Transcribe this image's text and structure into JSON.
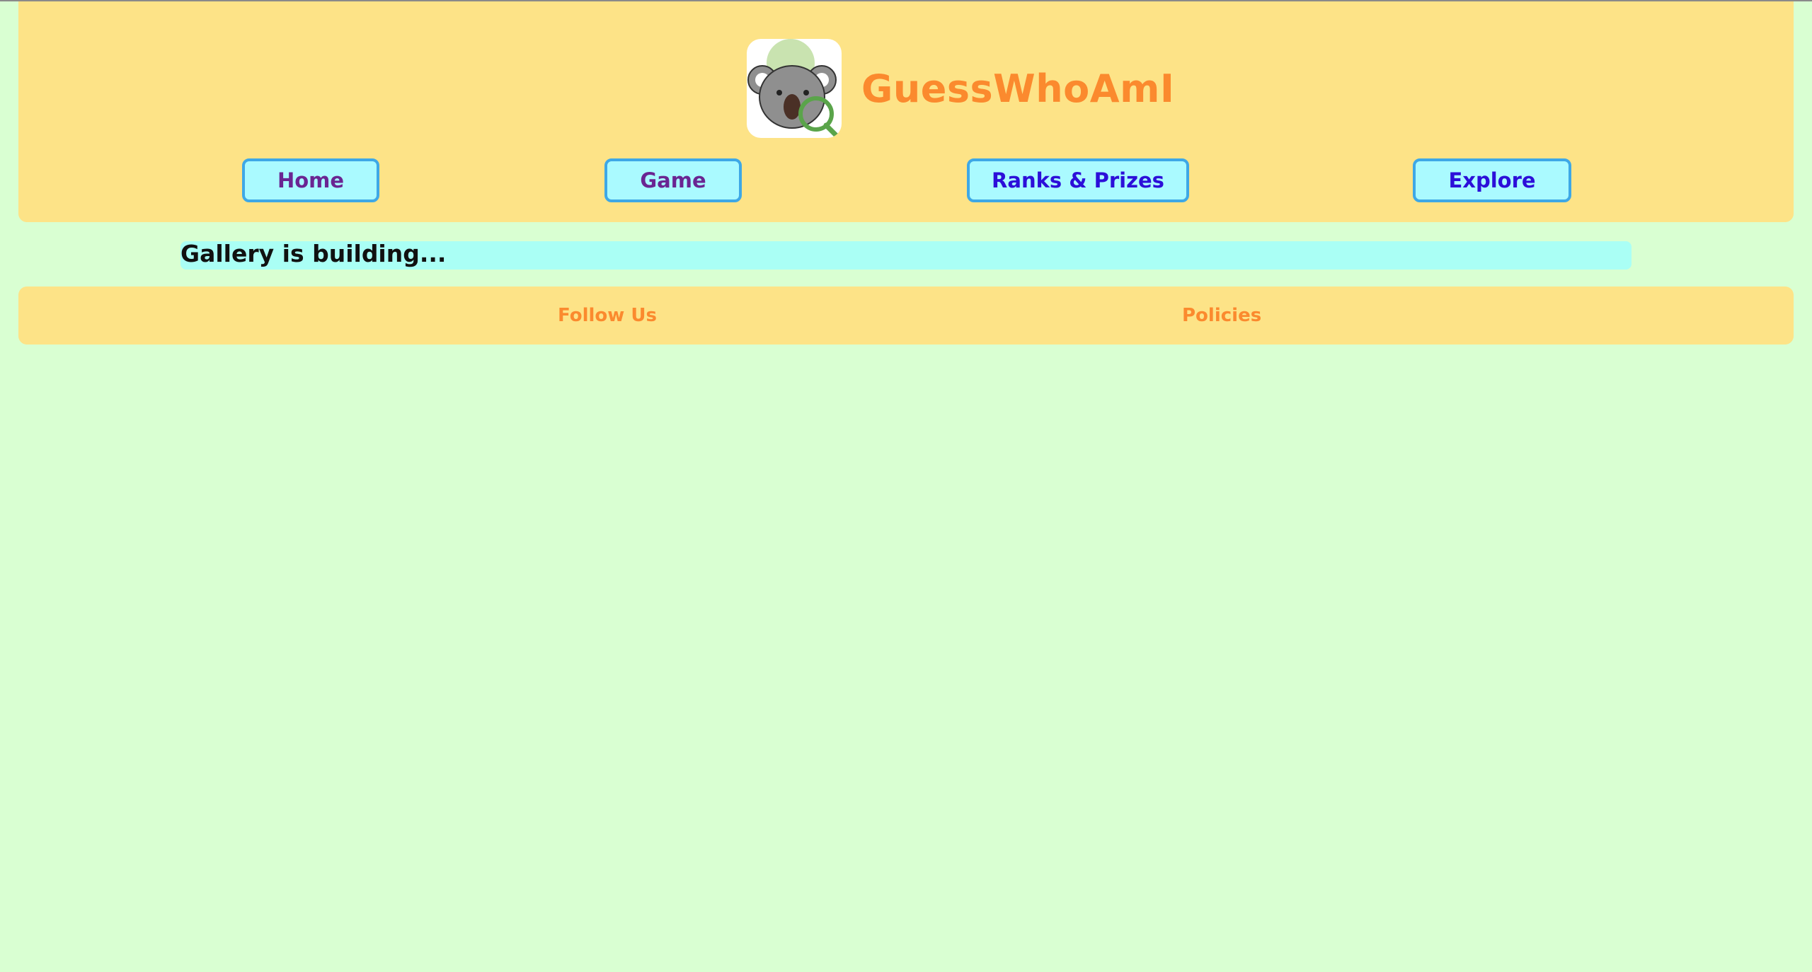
{
  "header": {
    "brand": "GuessWhoAmI",
    "logo_icon": "koala-magnifier-icon",
    "nav": [
      {
        "label": "Home"
      },
      {
        "label": "Game"
      },
      {
        "label": "Ranks & Prizes"
      },
      {
        "label": "Explore"
      }
    ]
  },
  "main": {
    "gallery_status": "Gallery is building..."
  },
  "footer": {
    "follow_label": "Follow Us",
    "policies_label": "Policies"
  },
  "colors": {
    "page_bg": "#d9ffd2",
    "panel_bg": "#fde387",
    "brand": "#fb8a2e",
    "button_bg": "#aafaff",
    "button_border": "#3ea8e6",
    "status_bar": "#aafff5"
  }
}
